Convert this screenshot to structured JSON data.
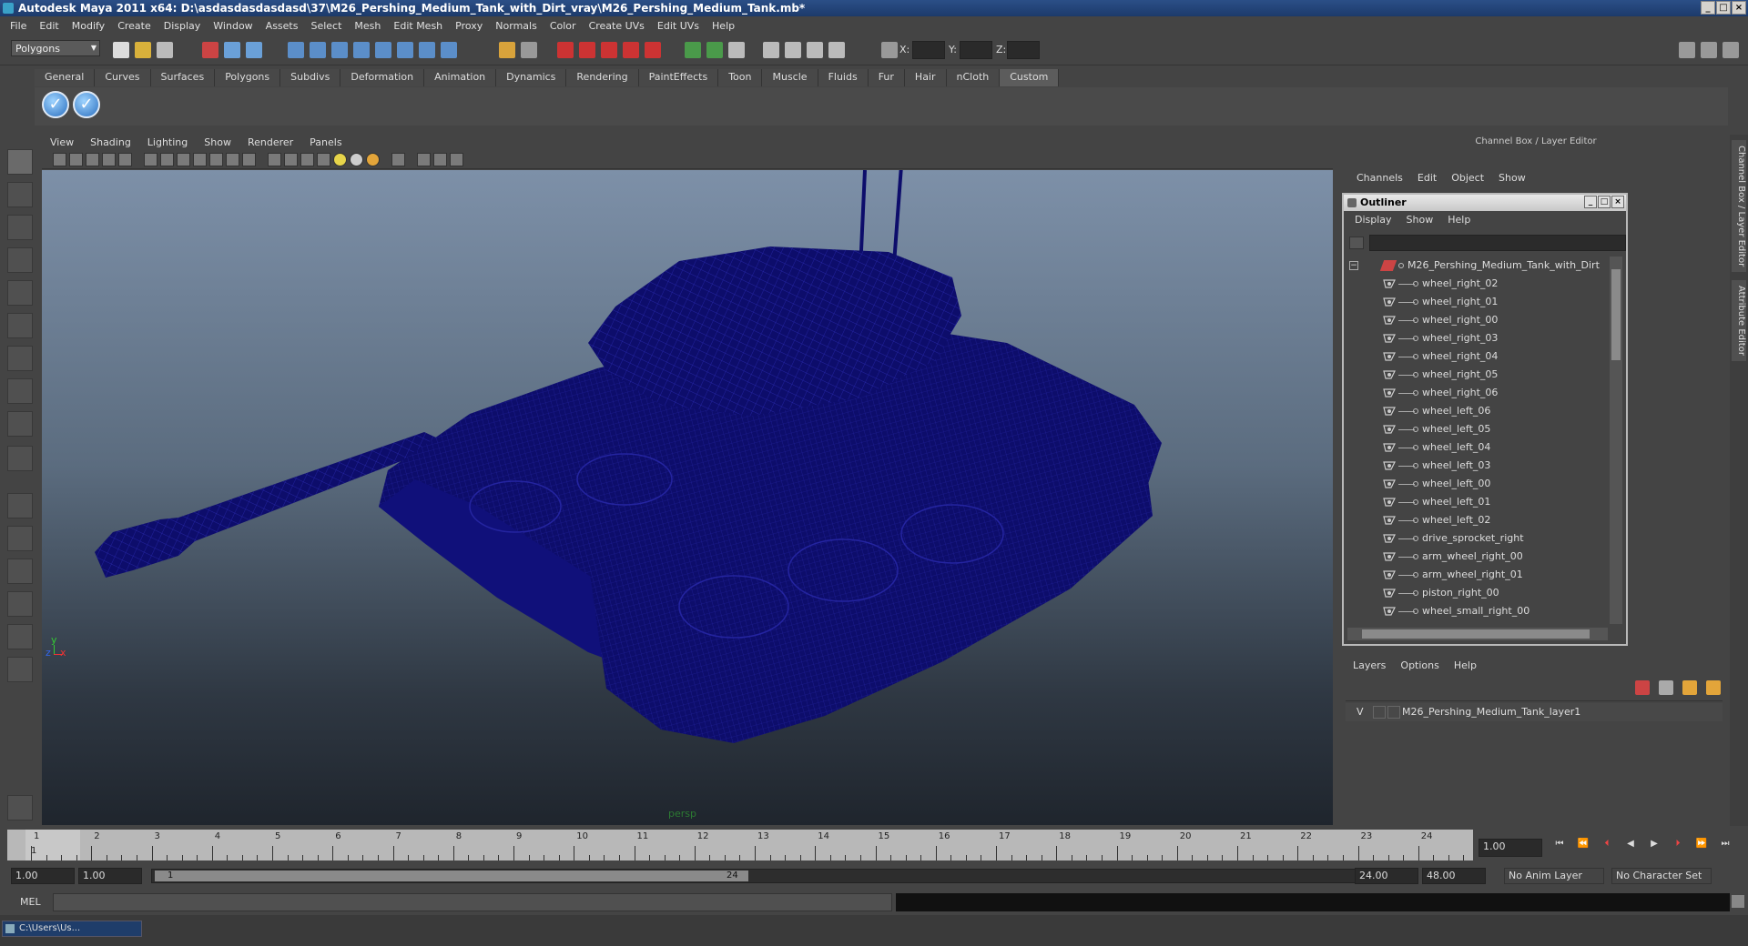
{
  "title": "Autodesk Maya 2011 x64: D:\\asdasdasdasdasd\\37\\M26_Pershing_Medium_Tank_with_Dirt_vray\\M26_Pershing_Medium_Tank.mb*",
  "menu": [
    "File",
    "Edit",
    "Modify",
    "Create",
    "Display",
    "Window",
    "Assets",
    "Select",
    "Mesh",
    "Edit Mesh",
    "Proxy",
    "Normals",
    "Color",
    "Create UVs",
    "Edit UVs",
    "Help"
  ],
  "mode_dropdown": "Polygons",
  "coord_labels": {
    "x": "X:",
    "y": "Y:",
    "z": "Z:"
  },
  "shelf_tabs": [
    "General",
    "Curves",
    "Surfaces",
    "Polygons",
    "Subdivs",
    "Deformation",
    "Animation",
    "Dynamics",
    "Rendering",
    "PaintEffects",
    "Toon",
    "Muscle",
    "Fluids",
    "Fur",
    "Hair",
    "nCloth",
    "Custom"
  ],
  "shelf_active": "Custom",
  "viewport_menu": [
    "View",
    "Shading",
    "Lighting",
    "Show",
    "Renderer",
    "Panels"
  ],
  "viewport_label": "persp",
  "axis": {
    "y": "y",
    "x": "x",
    "z": "z"
  },
  "channel_box": {
    "header": "Channel Box / Layer Editor",
    "menu": [
      "Channels",
      "Edit",
      "Object",
      "Show"
    ]
  },
  "side_tabs": [
    "Channel Box / Layer Editor",
    "Attribute Editor"
  ],
  "outliner": {
    "title": "Outliner",
    "menu": [
      "Display",
      "Show",
      "Help"
    ],
    "root": "M26_Pershing_Medium_Tank_with_Dirt",
    "items": [
      "wheel_right_02",
      "wheel_right_01",
      "wheel_right_00",
      "wheel_right_03",
      "wheel_right_04",
      "wheel_right_05",
      "wheel_right_06",
      "wheel_left_06",
      "wheel_left_05",
      "wheel_left_04",
      "wheel_left_03",
      "wheel_left_00",
      "wheel_left_01",
      "wheel_left_02",
      "drive_sprocket_right",
      "arm_wheel_right_00",
      "arm_wheel_right_01",
      "piston_right_00",
      "wheel_small_right_00"
    ]
  },
  "layer_editor": {
    "menu": [
      "Layers",
      "Options",
      "Help"
    ],
    "visibility": "V",
    "layer_name": "M26_Pershing_Medium_Tank_layer1"
  },
  "timeline": {
    "ticks": [
      "1",
      "2",
      "3",
      "4",
      "5",
      "6",
      "7",
      "8",
      "9",
      "10",
      "11",
      "12",
      "13",
      "14",
      "15",
      "16",
      "17",
      "18",
      "19",
      "20",
      "21",
      "22",
      "23",
      "24"
    ],
    "current_frame_value": "1",
    "current_time": "1.00"
  },
  "range": {
    "start": "1.00",
    "inner_start": "1.00",
    "slider_start": "1",
    "slider_end": "24",
    "end": "24.00",
    "outer_end": "48.00",
    "anim_layer": "No Anim Layer",
    "char_set": "No Character Set"
  },
  "command_line": {
    "label": "MEL"
  },
  "taskbar": {
    "item": "C:\\Users\\Us..."
  },
  "colors": {
    "wireframe": "#0d0d6b",
    "accent": "#2b4f87"
  }
}
